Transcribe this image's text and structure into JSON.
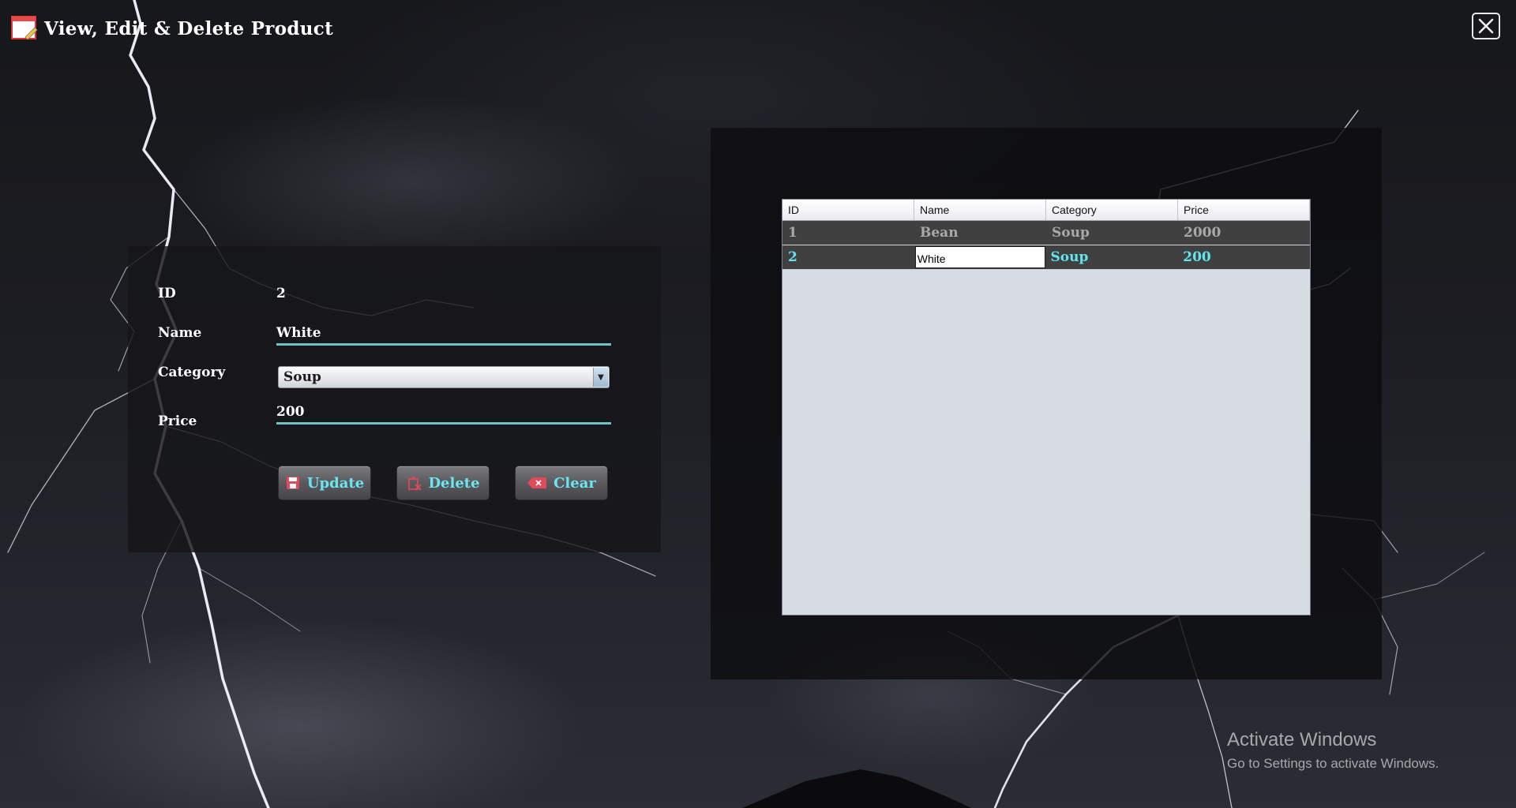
{
  "window": {
    "title": "View, Edit & Delete Product",
    "app_icon": "product-edit-icon",
    "close_icon": "close-icon"
  },
  "form": {
    "id_label": "ID",
    "id_value": "2",
    "name_label": "Name",
    "name_value": "White",
    "category_label": "Category",
    "category_value": "Soup",
    "price_label": "Price",
    "price_value": "200",
    "buttons": {
      "update": "Update",
      "delete": "Delete",
      "clear": "Clear"
    }
  },
  "table": {
    "columns": [
      "ID",
      "Name",
      "Category",
      "Price"
    ],
    "rows": [
      {
        "id": "1",
        "name": "Bean",
        "category": "Soup",
        "price": "2000"
      },
      {
        "id": "2",
        "name": "White",
        "category": "Soup",
        "price": "200"
      }
    ],
    "selected_row": 2
  },
  "watermark": {
    "title": "Activate Windows",
    "subtitle": "Go to Settings to activate Windows."
  },
  "colors": {
    "accent": "#6fc3c4",
    "button_text": "#6ce6ee",
    "row_background": "#404040"
  }
}
